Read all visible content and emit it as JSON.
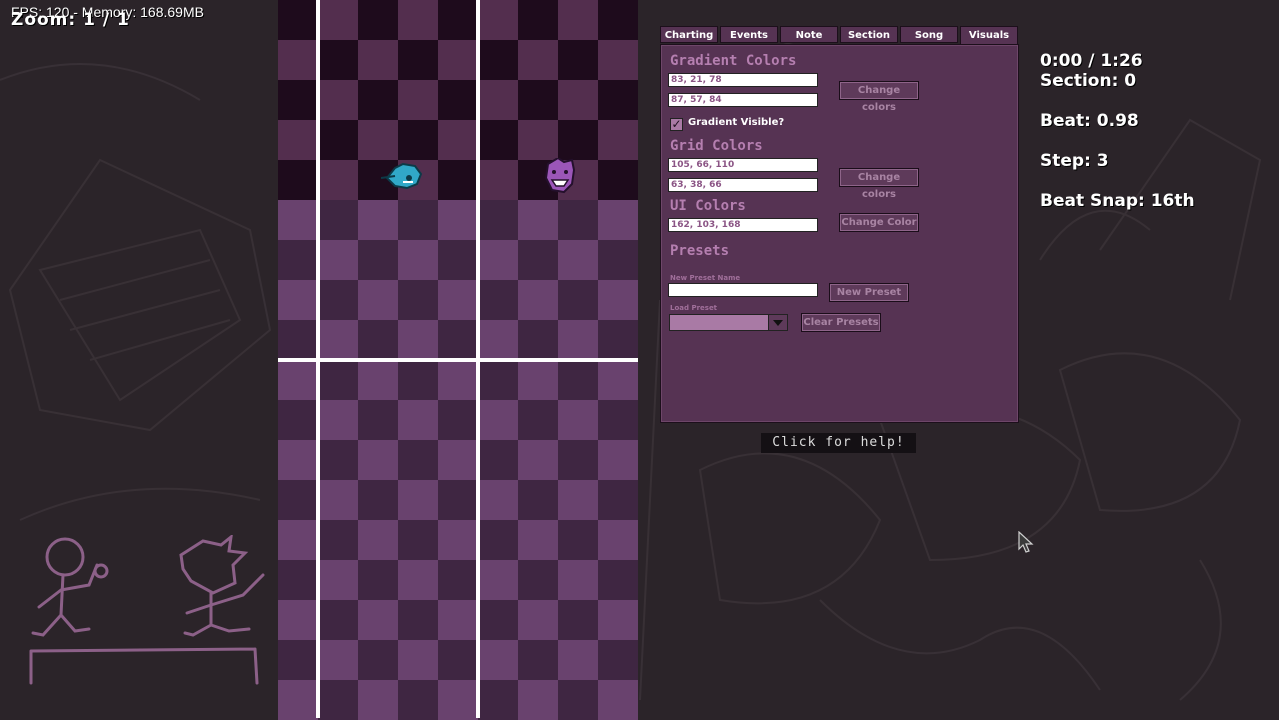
{
  "hud": {
    "fps_memory": "FPS: 120 - Memory: 168.69MB",
    "zoom": "Zoom: 1 / 1"
  },
  "tabs": [
    {
      "label": "Charting",
      "active": false
    },
    {
      "label": "Events",
      "active": false
    },
    {
      "label": "Note",
      "active": false
    },
    {
      "label": "Section",
      "active": false
    },
    {
      "label": "Song",
      "active": false
    },
    {
      "label": "Visuals",
      "active": true
    }
  ],
  "visuals": {
    "gradient_title": "Gradient Colors",
    "gradient_color_1": "83, 21, 78",
    "gradient_color_2": "87, 57, 84",
    "gradient_change_button": "Change colors",
    "gradient_visible_label": "Gradient Visible?",
    "gradient_visible_checked": true,
    "grid_title": "Grid Colors",
    "grid_color_1": "105, 66, 110",
    "grid_color_2": "63, 38, 66",
    "grid_change_button": "Change colors",
    "ui_title": "UI Colors",
    "ui_color": "162, 103, 168",
    "ui_change_button": "Change Color",
    "presets_title": "Presets",
    "new_preset_name_label": "New Preset Name",
    "new_preset_name_value": "",
    "new_preset_button": "New Preset",
    "load_preset_label": "Load Preset",
    "load_preset_value": "",
    "clear_presets_button": "Clear Presets"
  },
  "help_button": "Click for help!",
  "info": {
    "time": "0:00 / 1:26",
    "section": "Section: 0",
    "beat": "Beat: 0.98",
    "step": "Step: 3",
    "beat_snap": "Beat Snap: 16th"
  },
  "colors": {
    "bg": "#2b2429",
    "panel": "#563353",
    "grid_light": "#69426e",
    "grid_dark": "#3f2642",
    "grid_top_light": "#532e4e",
    "grid_top_dark": "#1e0b1c",
    "accent_text": "#b57fb0"
  },
  "icons": {
    "note_opponent": "boyfriend-health-icon",
    "note_player": "purple-opponent-health-icon",
    "cursor": "mouse-cursor-icon"
  }
}
